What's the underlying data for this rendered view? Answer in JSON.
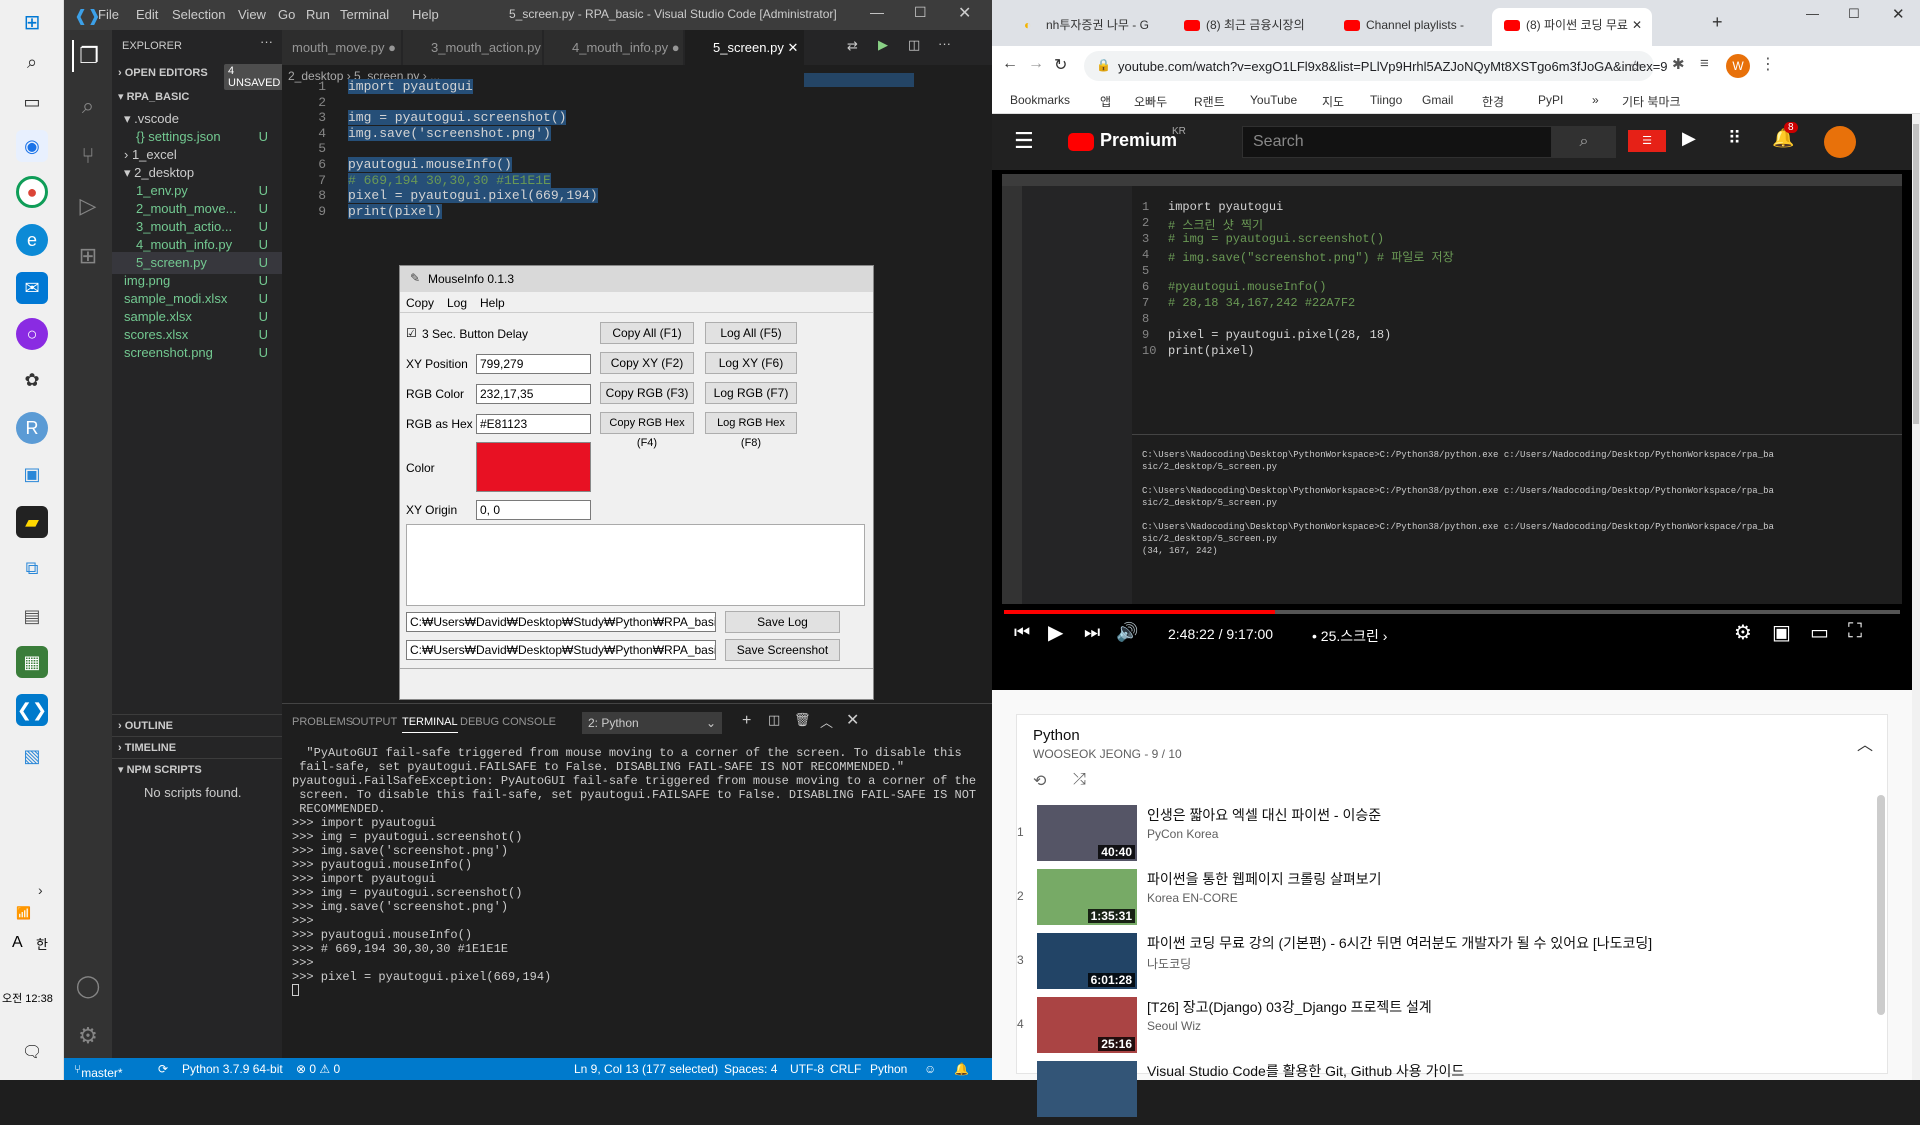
{
  "taskbar": {
    "time": "오전 12:38",
    "lang_a": "A",
    "lang_han": "한"
  },
  "vscode": {
    "menu": [
      "File",
      "Edit",
      "Selection",
      "View",
      "Go",
      "Run",
      "Terminal",
      "Help"
    ],
    "title": "5_screen.py - RPA_basic - Visual Studio Code [Administrator]",
    "explorer": {
      "header": "EXPLORER",
      "open_editors": "OPEN EDITORS",
      "unsaved": "4 UNSAVED",
      "root": "RPA_BASIC",
      "tree": [
        {
          "label": "▾ .vscode",
          "indent": 1,
          "u": ""
        },
        {
          "label": "{} settings.json",
          "indent": 2,
          "u": "U"
        },
        {
          "label": "› 1_excel",
          "indent": 1,
          "u": ""
        },
        {
          "label": "▾ 2_desktop",
          "indent": 1,
          "u": ""
        },
        {
          "label": "1_env.py",
          "indent": 2,
          "u": "U"
        },
        {
          "label": "2_mouth_move...",
          "indent": 2,
          "u": "U"
        },
        {
          "label": "3_mouth_actio...",
          "indent": 2,
          "u": "U"
        },
        {
          "label": "4_mouth_info.py",
          "indent": 2,
          "u": "U"
        },
        {
          "label": "5_screen.py",
          "indent": 2,
          "u": "U"
        },
        {
          "label": "img.png",
          "indent": 1,
          "u": "U"
        },
        {
          "label": "sample_modi.xlsx",
          "indent": 1,
          "u": "U"
        },
        {
          "label": "sample.xlsx",
          "indent": 1,
          "u": "U"
        },
        {
          "label": "scores.xlsx",
          "indent": 1,
          "u": "U"
        },
        {
          "label": "screenshot.png",
          "indent": 1,
          "u": "U"
        }
      ],
      "outline": "OUTLINE",
      "timeline": "TIMELINE",
      "npm": "NPM SCRIPTS",
      "no_scripts": "No scripts found."
    },
    "tabs": [
      "mouth_move.py",
      "3_mouth_action.py",
      "4_mouth_info.py",
      "5_screen.py"
    ],
    "breadcrumb": "2_desktop › 5_screen.py › ...",
    "code_lines": [
      "import pyautogui",
      "",
      "img = pyautogui.screenshot()",
      "img.save('screenshot.png')",
      "",
      "pyautogui.mouseInfo()",
      "# 669,194 30,30,30 #1E1E1E",
      "pixel = pyautogui.pixel(669,194)",
      "print(pixel)"
    ],
    "panel_tabs": [
      "PROBLEMS",
      "OUTPUT",
      "TERMINAL",
      "DEBUG CONSOLE"
    ],
    "terminal_select": "2: Python",
    "terminal_lines": [
      "  \"PyAutoGUI fail-safe triggered from mouse moving to a corner of the screen. To disable this",
      " fail-safe, set pyautogui.FAILSAFE to False. DISABLING FAIL-SAFE IS NOT RECOMMENDED.\"",
      "pyautogui.FailSafeException: PyAutoGUI fail-safe triggered from mouse moving to a corner of the",
      " screen. To disable this fail-safe, set pyautogui.FAILSAFE to False. DISABLING FAIL-SAFE IS NOT",
      " RECOMMENDED.",
      ">>> import pyautogui",
      ">>> img = pyautogui.screenshot()",
      ">>> img.save('screenshot.png')",
      ">>> pyautogui.mouseInfo()",
      ">>> import pyautogui",
      ">>> img = pyautogui.screenshot()",
      ">>> img.save('screenshot.png')",
      ">>>",
      ">>> pyautogui.mouseInfo()",
      ">>> # 669,194 30,30,30 #1E1E1E",
      ">>>",
      ">>> pixel = pyautogui.pixel(669,194)",
      ""
    ],
    "status": {
      "branch": "master*",
      "python": "Python 3.7.9 64-bit",
      "problems": "⊗ 0 ⚠ 0",
      "position": "Ln 9, Col 13 (177 selected)",
      "spaces": "Spaces: 4",
      "encoding": "UTF-8",
      "eol": "CRLF",
      "lang": "Python"
    }
  },
  "mouseinfo": {
    "title": "MouseInfo 0.1.3",
    "menu": [
      "Copy",
      "Log",
      "Help"
    ],
    "delay_label": "3 Sec. Button Delay",
    "xy_label": "XY Position",
    "xy_value": "799,279",
    "rgb_label": "RGB Color",
    "rgb_value": "232,17,35",
    "hex_label": "RGB as Hex",
    "hex_value": "#E81123",
    "color_label": "Color",
    "color_hex": "#E81123",
    "origin_label": "XY Origin",
    "origin_value": "0, 0",
    "buttons": {
      "copy_all": "Copy All (F1)",
      "log_all": "Log All (F5)",
      "copy_xy": "Copy XY (F2)",
      "log_xy": "Log XY (F6)",
      "copy_rgb": "Copy RGB (F3)",
      "log_rgb": "Log RGB (F7)",
      "copy_hex": "Copy RGB Hex (F4)",
      "log_hex": "Log RGB Hex (F8)",
      "save_log": "Save Log",
      "save_shot": "Save Screenshot"
    },
    "log_path": "C:₩Users₩David₩Desktop₩Study₩Python₩RPA_basic₩m",
    "shot_path": "C:₩Users₩David₩Desktop₩Study₩Python₩RPA_basic₩m"
  },
  "chrome": {
    "tabs": [
      "nh투자증권 나무 - G",
      "(8) 최근 금융시장의",
      "Channel playlists -",
      "(8) 파이썬 코딩 무료"
    ],
    "url": "youtube.com/watch?v=exgO1LFl9x8&list=PLlVp9Hrhl5AZJoNQyMt8XSTgo6m3fJoGA&index=9",
    "bookmarks": [
      "Bookmarks",
      "앱",
      "오빠두",
      "R랜트",
      "YouTube",
      "지도",
      "Tiingo",
      "Gmail",
      "한경",
      "PyPI",
      "»",
      "기타 북마크"
    ],
    "profile_letter": "W"
  },
  "youtube": {
    "logo": "Premium",
    "region": "KR",
    "search_placeholder": "Search",
    "notif_count": "8",
    "video": {
      "time": "2:48:22 / 9:17:00",
      "chapter": "• 25.스크린 ›",
      "progress": 0.302,
      "inner_code": [
        "import pyautogui",
        "# 스크린 샷 찍기",
        "# img = pyautogui.screenshot()",
        "# img.save(\"screenshot.png\") # 파일로 저장",
        "",
        "#pyautogui.mouseInfo()",
        "# 28,18 34,167,242 #22A7F2",
        "",
        "pixel = pyautogui.pixel(28, 18)",
        "print(pixel)"
      ],
      "inner_term": [
        "C:\\Users\\Nadocoding\\Desktop\\PythonWorkspace>C:/Python38/python.exe c:/Users/Nadocoding/Desktop/PythonWorkspace/rpa_ba",
        "sic/2_desktop/5_screen.py",
        "",
        "C:\\Users\\Nadocoding\\Desktop\\PythonWorkspace>C:/Python38/python.exe c:/Users/Nadocoding/Desktop/PythonWorkspace/rpa_ba",
        "sic/2_desktop/5_screen.py",
        "",
        "C:\\Users\\Nadocoding\\Desktop\\PythonWorkspace>C:/Python38/python.exe c:/Users/Nadocoding/Desktop/PythonWorkspace/rpa_ba",
        "sic/2_desktop/5_screen.py",
        "(34, 167, 242)"
      ]
    },
    "playlist": {
      "title": "Python",
      "sub": "WOOSEOK JEONG - 9 / 10",
      "items": [
        {
          "num": "1",
          "title": "인생은 짧아요 엑셀 대신 파이썬 - 이승준",
          "channel": "PyCon Korea",
          "dur": "40:40"
        },
        {
          "num": "2",
          "title": "파이썬을 통한 웹페이지 크롤링 살펴보기",
          "channel": "Korea EN-CORE",
          "dur": "1:35:31"
        },
        {
          "num": "3",
          "title": "파이썬 코딩 무료 강의 (기본편) - 6시간 뒤면 여러분도 개발자가 될 수 있어요 [나도코딩]",
          "channel": "나도코딩",
          "dur": "6:01:28"
        },
        {
          "num": "4",
          "title": "[T26] 장고(Django) 03강_Django 프로젝트 설계",
          "channel": "Seoul Wiz",
          "dur": "25:16"
        },
        {
          "num": "",
          "title": "Visual Studio Code를 활용한 Git, Github 사용 가이드",
          "channel": "",
          "dur": ""
        }
      ]
    }
  }
}
